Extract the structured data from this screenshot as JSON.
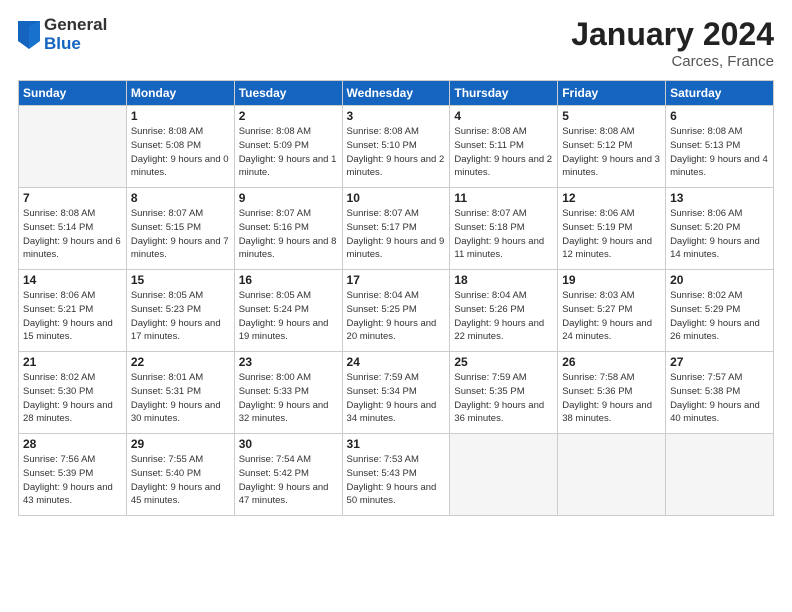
{
  "header": {
    "logo_general": "General",
    "logo_blue": "Blue",
    "month_title": "January 2024",
    "location": "Carces, France"
  },
  "days_of_week": [
    "Sunday",
    "Monday",
    "Tuesday",
    "Wednesday",
    "Thursday",
    "Friday",
    "Saturday"
  ],
  "weeks": [
    [
      {
        "day": "",
        "empty": true
      },
      {
        "day": "1",
        "sunrise": "8:08 AM",
        "sunset": "5:08 PM",
        "daylight": "9 hours and 0 minutes."
      },
      {
        "day": "2",
        "sunrise": "8:08 AM",
        "sunset": "5:09 PM",
        "daylight": "9 hours and 1 minute."
      },
      {
        "day": "3",
        "sunrise": "8:08 AM",
        "sunset": "5:10 PM",
        "daylight": "9 hours and 2 minutes."
      },
      {
        "day": "4",
        "sunrise": "8:08 AM",
        "sunset": "5:11 PM",
        "daylight": "9 hours and 2 minutes."
      },
      {
        "day": "5",
        "sunrise": "8:08 AM",
        "sunset": "5:12 PM",
        "daylight": "9 hours and 3 minutes."
      },
      {
        "day": "6",
        "sunrise": "8:08 AM",
        "sunset": "5:13 PM",
        "daylight": "9 hours and 4 minutes."
      }
    ],
    [
      {
        "day": "7",
        "sunrise": "8:08 AM",
        "sunset": "5:14 PM",
        "daylight": "9 hours and 6 minutes."
      },
      {
        "day": "8",
        "sunrise": "8:07 AM",
        "sunset": "5:15 PM",
        "daylight": "9 hours and 7 minutes."
      },
      {
        "day": "9",
        "sunrise": "8:07 AM",
        "sunset": "5:16 PM",
        "daylight": "9 hours and 8 minutes."
      },
      {
        "day": "10",
        "sunrise": "8:07 AM",
        "sunset": "5:17 PM",
        "daylight": "9 hours and 9 minutes."
      },
      {
        "day": "11",
        "sunrise": "8:07 AM",
        "sunset": "5:18 PM",
        "daylight": "9 hours and 11 minutes."
      },
      {
        "day": "12",
        "sunrise": "8:06 AM",
        "sunset": "5:19 PM",
        "daylight": "9 hours and 12 minutes."
      },
      {
        "day": "13",
        "sunrise": "8:06 AM",
        "sunset": "5:20 PM",
        "daylight": "9 hours and 14 minutes."
      }
    ],
    [
      {
        "day": "14",
        "sunrise": "8:06 AM",
        "sunset": "5:21 PM",
        "daylight": "9 hours and 15 minutes."
      },
      {
        "day": "15",
        "sunrise": "8:05 AM",
        "sunset": "5:23 PM",
        "daylight": "9 hours and 17 minutes."
      },
      {
        "day": "16",
        "sunrise": "8:05 AM",
        "sunset": "5:24 PM",
        "daylight": "9 hours and 19 minutes."
      },
      {
        "day": "17",
        "sunrise": "8:04 AM",
        "sunset": "5:25 PM",
        "daylight": "9 hours and 20 minutes."
      },
      {
        "day": "18",
        "sunrise": "8:04 AM",
        "sunset": "5:26 PM",
        "daylight": "9 hours and 22 minutes."
      },
      {
        "day": "19",
        "sunrise": "8:03 AM",
        "sunset": "5:27 PM",
        "daylight": "9 hours and 24 minutes."
      },
      {
        "day": "20",
        "sunrise": "8:02 AM",
        "sunset": "5:29 PM",
        "daylight": "9 hours and 26 minutes."
      }
    ],
    [
      {
        "day": "21",
        "sunrise": "8:02 AM",
        "sunset": "5:30 PM",
        "daylight": "9 hours and 28 minutes."
      },
      {
        "day": "22",
        "sunrise": "8:01 AM",
        "sunset": "5:31 PM",
        "daylight": "9 hours and 30 minutes."
      },
      {
        "day": "23",
        "sunrise": "8:00 AM",
        "sunset": "5:33 PM",
        "daylight": "9 hours and 32 minutes."
      },
      {
        "day": "24",
        "sunrise": "7:59 AM",
        "sunset": "5:34 PM",
        "daylight": "9 hours and 34 minutes."
      },
      {
        "day": "25",
        "sunrise": "7:59 AM",
        "sunset": "5:35 PM",
        "daylight": "9 hours and 36 minutes."
      },
      {
        "day": "26",
        "sunrise": "7:58 AM",
        "sunset": "5:36 PM",
        "daylight": "9 hours and 38 minutes."
      },
      {
        "day": "27",
        "sunrise": "7:57 AM",
        "sunset": "5:38 PM",
        "daylight": "9 hours and 40 minutes."
      }
    ],
    [
      {
        "day": "28",
        "sunrise": "7:56 AM",
        "sunset": "5:39 PM",
        "daylight": "9 hours and 43 minutes."
      },
      {
        "day": "29",
        "sunrise": "7:55 AM",
        "sunset": "5:40 PM",
        "daylight": "9 hours and 45 minutes."
      },
      {
        "day": "30",
        "sunrise": "7:54 AM",
        "sunset": "5:42 PM",
        "daylight": "9 hours and 47 minutes."
      },
      {
        "day": "31",
        "sunrise": "7:53 AM",
        "sunset": "5:43 PM",
        "daylight": "9 hours and 50 minutes."
      },
      {
        "day": "",
        "empty": true
      },
      {
        "day": "",
        "empty": true
      },
      {
        "day": "",
        "empty": true
      }
    ]
  ],
  "labels": {
    "sunrise": "Sunrise:",
    "sunset": "Sunset:",
    "daylight": "Daylight:"
  }
}
